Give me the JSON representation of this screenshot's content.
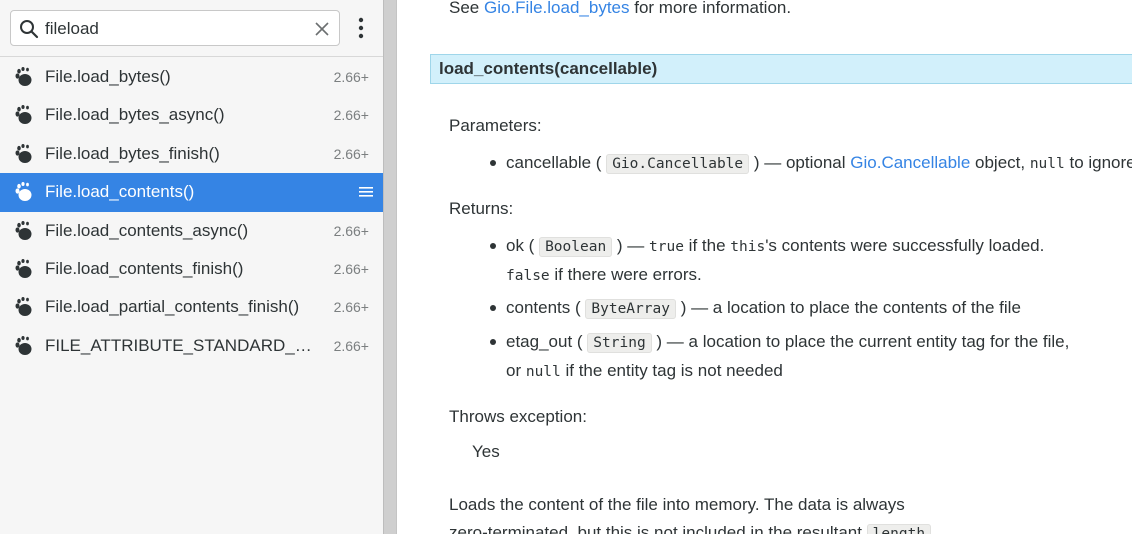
{
  "search": {
    "value": "fileload",
    "icons": {
      "search": "magnifier-icon",
      "clear": "clear-x-icon",
      "menu": "vertical-dots-icon"
    }
  },
  "results": [
    {
      "label": "File.load_bytes()",
      "version": "2.66+",
      "selected": false
    },
    {
      "label": "File.load_bytes_async()",
      "version": "2.66+",
      "selected": false
    },
    {
      "label": "File.load_bytes_finish()",
      "version": "2.66+",
      "selected": false
    },
    {
      "label": "File.load_contents()",
      "version": "",
      "selected": true
    },
    {
      "label": "File.load_contents_async()",
      "version": "2.66+",
      "selected": false
    },
    {
      "label": "File.load_contents_finish()",
      "version": "2.66+",
      "selected": false
    },
    {
      "label": "File.load_partial_contents_finish()",
      "version": "2.66+",
      "selected": false
    },
    {
      "label": "FILE_ATTRIBUTE_STANDARD_ALLOCATED_SIZE",
      "version": "2.66+",
      "selected": false
    }
  ],
  "colors": {
    "accent": "#3584e4",
    "signature_bg": "#d2f0fb",
    "link": "#3584e4"
  },
  "doc": {
    "see_prefix": "See ",
    "see_link": "Gio.File.load_bytes",
    "see_suffix": " for more information.",
    "signature": "load_contents(cancellable)",
    "parameters_heading": "Parameters:",
    "param": {
      "name": "cancellable (",
      "type": "Gio.Cancellable",
      "mid": ") — optional ",
      "link": "Gio.Cancellable",
      "after": " object, ",
      "null": "null",
      "end": " to ignore"
    },
    "returns_heading": "Returns:",
    "ret_ok": {
      "name": "ok (",
      "type": "Boolean",
      "mid": ") — ",
      "true": "true",
      "if_the": " if the ",
      "this": "this",
      "rest": "'s contents were successfully loaded.",
      "false": "false",
      "false_rest": " if there were errors."
    },
    "ret_contents": {
      "name": "contents (",
      "type": "ByteArray",
      "rest": ") — a location to place the contents of the file"
    },
    "ret_etag": {
      "name": "etag_out (",
      "type": "String",
      "rest": ") — a location to place the current entity tag for the file,",
      "or": "or ",
      "null": "null",
      "rest2": " if the entity tag is not needed"
    },
    "throws_heading": "Throws exception:",
    "throws_value": "Yes",
    "desc_line1": "Loads the content of the file into memory. The data is always",
    "desc_line2": "zero-terminated, but this is not included in the resultant ",
    "desc_code": "length"
  }
}
